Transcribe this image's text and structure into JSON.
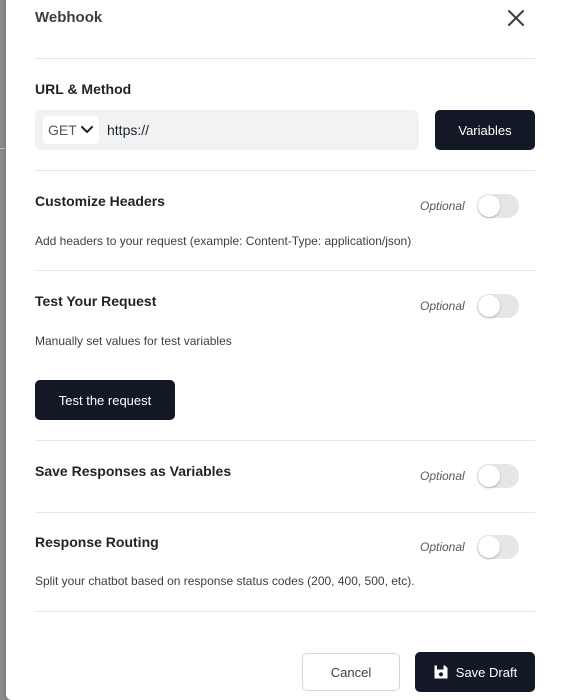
{
  "modal": {
    "title": "Webhook"
  },
  "url_method": {
    "heading": "URL & Method",
    "method": "GET",
    "url_placeholder": "https://",
    "variables_label": "Variables"
  },
  "sections": [
    {
      "title": "Customize Headers",
      "optional": "Optional",
      "description": "Add headers to your request (example: Content-Type: application/json)",
      "enabled": false
    },
    {
      "title": "Test Your Request",
      "optional": "Optional",
      "description": "Manually set values for test variables",
      "button": "Test the request",
      "enabled": false
    },
    {
      "title": "Save Responses as Variables",
      "optional": "Optional",
      "enabled": false
    },
    {
      "title": "Response Routing",
      "optional": "Optional",
      "description": "Split your chatbot based on response status codes (200, 400, 500, etc).",
      "enabled": false
    }
  ],
  "footer": {
    "cancel_label": "Cancel",
    "save_label": "Save Draft"
  },
  "icons": {
    "close": "close-icon",
    "chevron": "chevron-down-icon",
    "save": "floppy-disk-icon"
  },
  "colors": {
    "primary": "#121826",
    "toggle_off": "#e5e6e8"
  }
}
